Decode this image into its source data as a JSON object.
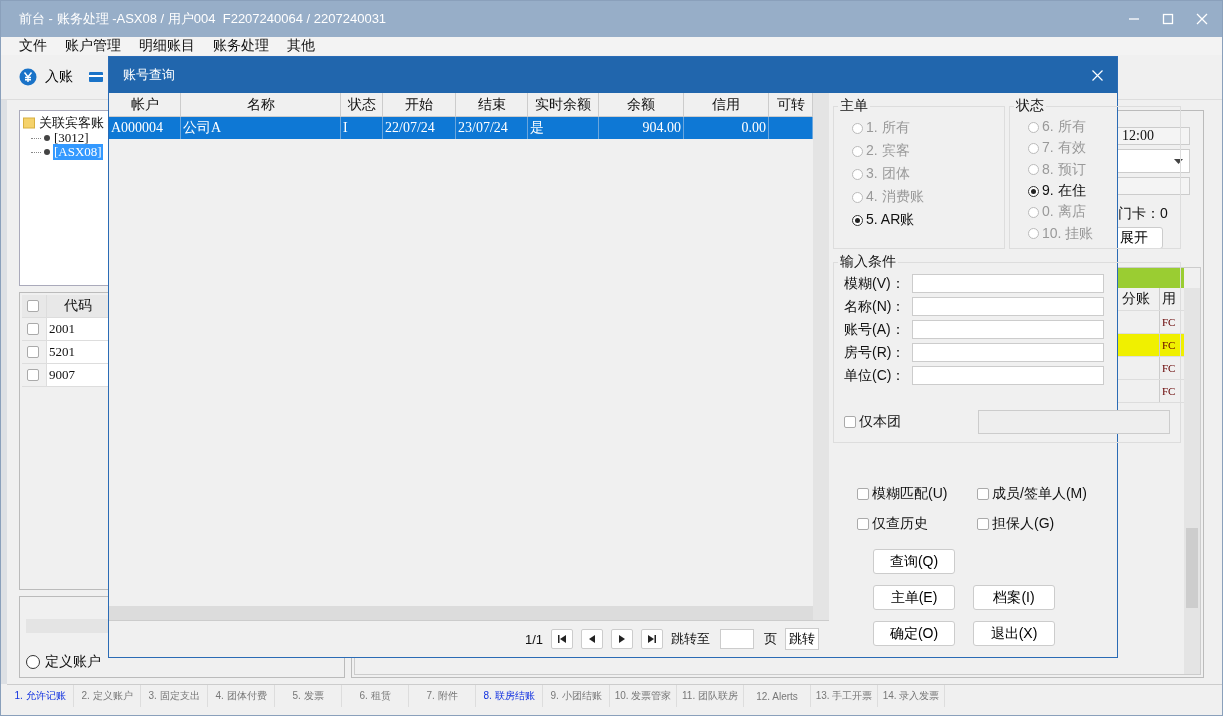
{
  "window": {
    "title": "前台 - 账务处理 -ASX08 / 用户004  F2207240064 / 2207240031"
  },
  "menu": [
    "文件",
    "账户管理",
    "明细账目",
    "账务处理",
    "其他"
  ],
  "toolbar": [
    {
      "label": "入账"
    }
  ],
  "tree": {
    "root": "关联宾客账",
    "children": [
      {
        "label": "[3012]",
        "selected": false
      },
      {
        "label": "[ASX08]",
        "selected": true
      }
    ]
  },
  "code_table": {
    "header_checked": false,
    "column": "代码",
    "rows": [
      {
        "code": "2001",
        "checked": false
      },
      {
        "code": "5201",
        "checked": false
      },
      {
        "code": "9007",
        "checked": false
      }
    ]
  },
  "account_radio": {
    "label": "定义账户",
    "selected": false
  },
  "info": {
    "time": "12:00",
    "card": "门卡：0",
    "expand_button": "展开"
  },
  "detail_table": {
    "columns": [
      "分账",
      "用"
    ],
    "rows": [
      {
        "column_2": "FC",
        "highlighted": false
      },
      {
        "column_2": "FC",
        "highlighted": true
      },
      {
        "column_2": "FC",
        "highlighted": false
      },
      {
        "column_2": "FC",
        "highlighted": false
      }
    ]
  },
  "tabs": [
    {
      "label": "1. 允许记账",
      "highlighted": true
    },
    {
      "label": "2. 定义账户",
      "highlighted": false
    },
    {
      "label": "3. 固定支出",
      "highlighted": false
    },
    {
      "label": "4. 团体付费",
      "highlighted": false
    },
    {
      "label": "5. 发票",
      "highlighted": false
    },
    {
      "label": "6. 租赁",
      "highlighted": false
    },
    {
      "label": "7. 附件",
      "highlighted": false
    },
    {
      "label": "8. 联房结账",
      "highlighted": true
    },
    {
      "label": "9. 小团结账",
      "highlighted": false
    },
    {
      "label": "10. 发票管家",
      "highlighted": false
    },
    {
      "label": "11. 团队联房",
      "highlighted": false
    },
    {
      "label": "12. Alerts",
      "highlighted": false
    },
    {
      "label": "13. 手工开票",
      "highlighted": false
    },
    {
      "label": "14. 录入发票",
      "highlighted": false
    }
  ],
  "dialog": {
    "title": "账号查询",
    "table": {
      "columns": [
        {
          "label": "帐户",
          "kind": "text"
        },
        {
          "label": "名称",
          "kind": "text"
        },
        {
          "label": "状态",
          "kind": "text"
        },
        {
          "label": "开始",
          "kind": "text"
        },
        {
          "label": "结束",
          "kind": "text"
        },
        {
          "label": "实时余额",
          "kind": "text"
        },
        {
          "label": "余额",
          "kind": "number"
        },
        {
          "label": "信用",
          "kind": "number"
        },
        {
          "label": "可转",
          "kind": "number"
        }
      ],
      "rows": [
        {
          "cells": [
            "A000004",
            "公司A",
            "I",
            "22/07/24",
            "23/07/24",
            "是",
            "904.00",
            "0.00"
          ],
          "selected": true
        }
      ]
    },
    "pager": {
      "page": "1/1",
      "goto_label": "跳转至",
      "page_unit": "页",
      "goto_button": "跳转"
    },
    "master_group": {
      "title": "主单",
      "options": [
        {
          "label": "1. 所有",
          "selected": false,
          "disabled": true
        },
        {
          "label": "2. 宾客",
          "selected": false,
          "disabled": true
        },
        {
          "label": "3. 团体",
          "selected": false,
          "disabled": true
        },
        {
          "label": "4. 消费账",
          "selected": false,
          "disabled": true
        },
        {
          "label": "5. AR账",
          "selected": true,
          "disabled": false
        }
      ]
    },
    "status_group": {
      "title": "状态",
      "options": [
        {
          "label": "6. 所有",
          "selected": false,
          "disabled": true
        },
        {
          "label": "7. 有效",
          "selected": false,
          "disabled": true
        },
        {
          "label": "8. 预订",
          "selected": false,
          "disabled": true
        },
        {
          "label": "9. 在住",
          "selected": true,
          "disabled": false
        },
        {
          "label": "0. 离店",
          "selected": false,
          "disabled": true
        },
        {
          "label": "10. 挂账",
          "selected": false,
          "disabled": true
        }
      ]
    },
    "conditions": {
      "title": "输入条件",
      "fields": [
        {
          "label": "模糊(V)："
        },
        {
          "label": "名称(N)："
        },
        {
          "label": "账号(A)："
        },
        {
          "label": "房号(R)："
        },
        {
          "label": "单位(C)："
        }
      ],
      "group_only": {
        "label": "仅本团",
        "checked": false
      }
    },
    "options": [
      {
        "label": "模糊匹配(U)",
        "checked": false
      },
      {
        "label": "成员/签单人(M)",
        "checked": false
      },
      {
        "label": "仅查历史",
        "checked": false
      },
      {
        "label": "担保人(G)",
        "checked": false
      }
    ],
    "buttons": [
      {
        "label": "查询(Q)"
      },
      {
        "label": "主单(E)"
      },
      {
        "label": "档案(I)"
      },
      {
        "label": "确定(O)"
      },
      {
        "label": "退出(X)"
      }
    ]
  }
}
